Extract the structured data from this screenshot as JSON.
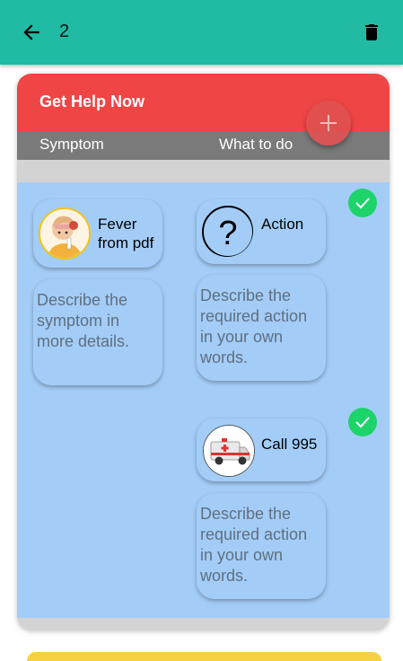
{
  "appbar": {
    "title": "2",
    "back_icon": "arrow-back-icon",
    "delete_icon": "trash-icon"
  },
  "card": {
    "title": "Get Help Now",
    "columns": {
      "symptom": "Symptom",
      "action": "What to do"
    },
    "add_icon": "plus-icon"
  },
  "rows": [
    {
      "symptom": {
        "label": "Fever from pdf",
        "label_line1": "Fever",
        "label_line2": "from pdf",
        "icon": "sick-person-icon",
        "description_placeholder": "Describe the symptom in more details."
      },
      "action": {
        "label": "Action",
        "icon": "question-mark-icon",
        "description_placeholder": "Describe the required action in your own words."
      },
      "status_icon": "check-icon"
    },
    {
      "action": {
        "label": "Call 995",
        "icon": "ambulance-icon",
        "description_placeholder": "Describe the required action in your own words."
      },
      "status_icon": "check-icon"
    }
  ],
  "colors": {
    "appbar": "#21bba4",
    "header": "#f04545",
    "column_header": "#7a7a7a",
    "area": "#a3cdf7",
    "check": "#1dd46a"
  }
}
